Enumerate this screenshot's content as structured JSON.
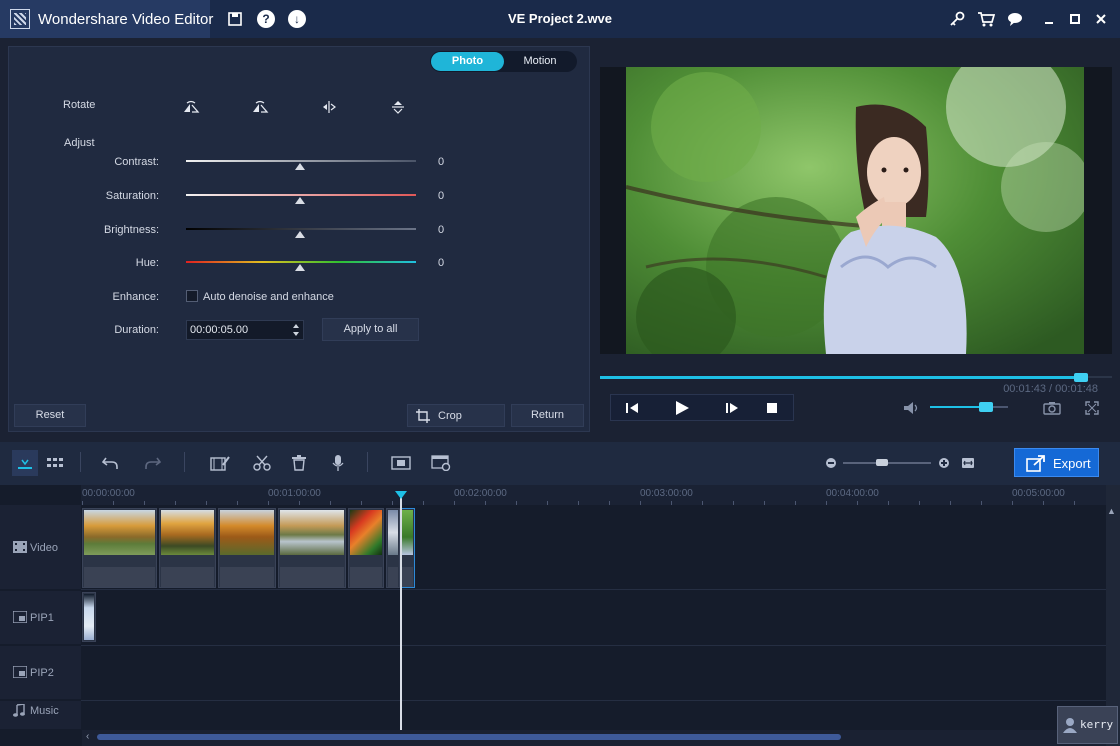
{
  "app": {
    "name": "Wondershare Video Editor",
    "window_title": "VE Project 2.wve"
  },
  "edit_panel": {
    "tabs": [
      {
        "label": "Photo",
        "active": true
      },
      {
        "label": "Motion",
        "active": false
      }
    ],
    "rotate_label": "Rotate",
    "adjust_label": "Adjust",
    "sliders": [
      {
        "label": "Contrast:",
        "value": "0"
      },
      {
        "label": "Saturation:",
        "value": "0"
      },
      {
        "label": "Brightness:",
        "value": "0"
      },
      {
        "label": "Hue:",
        "value": "0"
      }
    ],
    "enhance_label": "Enhance:",
    "enhance_option": "Auto denoise and enhance",
    "duration_label": "Duration:",
    "duration_value": "00:00:05.00",
    "apply_all": "Apply to all",
    "reset": "Reset",
    "crop": "Crop",
    "return": "Return"
  },
  "preview": {
    "time_current": "00:01:43",
    "time_total": "00:01:48",
    "time_text": "00:01:43 / 00:01:48",
    "progress": 0.94,
    "volume": 0.72
  },
  "toolbar": {
    "export": "Export"
  },
  "timeline": {
    "ruler": [
      "00:00:00:00",
      "00:01:00:00",
      "00:02:00:00",
      "00:03:00:00",
      "00:04:00:00",
      "00:05:00:00"
    ],
    "tracks": [
      "Video",
      "PIP1",
      "PIP2",
      "Music"
    ]
  },
  "watermark": "kerry",
  "colors": {
    "accent": "#1fb5d8",
    "export_blue": "#1569d6",
    "titlebar": "#1a2a4a"
  }
}
